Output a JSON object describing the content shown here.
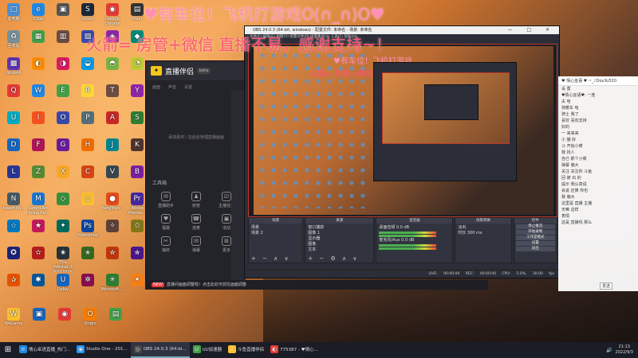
{
  "overlay": {
    "line1": "♥有车位！飞机打游戏O(∩_∩)O♥",
    "line2": "火箭= 房管+微信 直播不易，感谢支持~！"
  },
  "desktop_icons": [
    {
      "label": "此电脑",
      "color": "#4a90d9",
      "glyph": "□"
    },
    {
      "label": "Edge",
      "color": "#1e88e5",
      "glyph": "e"
    },
    {
      "label": "",
      "color": "#555",
      "glyph": "▣"
    },
    {
      "label": "Steam",
      "color": "#1b2838",
      "glyph": "S"
    },
    {
      "label": "Google Chrome",
      "color": "#e53935",
      "glyph": "◉"
    },
    {
      "label": "Steer",
      "color": "#333",
      "glyph": "▤"
    },
    {
      "label": "回收站",
      "color": "#78909c",
      "glyph": "♻"
    },
    {
      "label": "",
      "color": "#43a047",
      "glyph": "▦"
    },
    {
      "label": "",
      "color": "#6d4c41",
      "glyph": "▥"
    },
    {
      "label": "",
      "color": "#3949ab",
      "glyph": "▧"
    },
    {
      "label": "",
      "color": "#8e24aa",
      "glyph": "◈"
    },
    {
      "label": "",
      "color": "#00897b",
      "glyph": "◆"
    },
    {
      "label": "WinRAR",
      "color": "#5e35b1",
      "glyph": "▩"
    },
    {
      "label": "",
      "color": "#fb8c00",
      "glyph": "◐"
    },
    {
      "label": "",
      "color": "#d81b60",
      "glyph": "◑"
    },
    {
      "label": "",
      "color": "#039be5",
      "glyph": "◒"
    },
    {
      "label": "",
      "color": "#7cb342",
      "glyph": "◓"
    },
    {
      "label": "",
      "color": "#c0ca33",
      "glyph": "◔"
    },
    {
      "label": "",
      "color": "#e53935",
      "glyph": "Q"
    },
    {
      "label": "",
      "color": "#1e88e5",
      "glyph": "W"
    },
    {
      "label": "",
      "color": "#43a047",
      "glyph": "E"
    },
    {
      "label": "",
      "color": "#fdd835",
      "glyph": "R"
    },
    {
      "label": "",
      "color": "#6d4c41",
      "glyph": "T"
    },
    {
      "label": "",
      "color": "#8e24aa",
      "glyph": "Y"
    },
    {
      "label": "",
      "color": "#00acc1",
      "glyph": "U"
    },
    {
      "label": "",
      "color": "#f4511e",
      "glyph": "I"
    },
    {
      "label": "",
      "color": "#3949ab",
      "glyph": "O"
    },
    {
      "label": "",
      "color": "#546e7a",
      "glyph": "P"
    },
    {
      "label": "",
      "color": "#c62828",
      "glyph": "A"
    },
    {
      "label": "",
      "color": "#2e7d32",
      "glyph": "S"
    },
    {
      "label": "",
      "color": "#1565c0",
      "glyph": "D"
    },
    {
      "label": "",
      "color": "#ad1457",
      "glyph": "F"
    },
    {
      "label": "",
      "color": "#6a1b9a",
      "glyph": "G"
    },
    {
      "label": "",
      "color": "#ef6c00",
      "glyph": "H"
    },
    {
      "label": "",
      "color": "#00838f",
      "glyph": "J"
    },
    {
      "label": "",
      "color": "#4e342e",
      "glyph": "K"
    },
    {
      "label": "",
      "color": "#283593",
      "glyph": "L"
    },
    {
      "label": "",
      "color": "#558b2f",
      "glyph": "Z"
    },
    {
      "label": "",
      "color": "#f9a825",
      "glyph": "X"
    },
    {
      "label": "",
      "color": "#d84315",
      "glyph": "C"
    },
    {
      "label": "",
      "color": "#37474f",
      "glyph": "V"
    },
    {
      "label": "",
      "color": "#7b1fa2",
      "glyph": "B"
    },
    {
      "label": "Assembly...",
      "color": "#455a64",
      "glyph": "N"
    },
    {
      "label": "Sword Art Online Fat...",
      "color": "#1976d2",
      "glyph": "M"
    },
    {
      "label": "",
      "color": "#388e3c",
      "glyph": "◇"
    },
    {
      "label": "",
      "color": "#fbc02d",
      "glyph": "○"
    },
    {
      "label": "PangMan...",
      "color": "#e64a19",
      "glyph": "●"
    },
    {
      "label": "Adobe Premie...",
      "color": "#4527a0",
      "glyph": "Pr"
    },
    {
      "label": "",
      "color": "#0277bd",
      "glyph": "☆"
    },
    {
      "label": "",
      "color": "#c2185b",
      "glyph": "★"
    },
    {
      "label": "",
      "color": "#00695c",
      "glyph": "✦"
    },
    {
      "label": "Photoshop",
      "color": "#0d47a1",
      "glyph": "Ps"
    },
    {
      "label": "",
      "color": "#5d4037",
      "glyph": "✧"
    },
    {
      "label": "",
      "color": "#827717",
      "glyph": "✩"
    },
    {
      "label": "",
      "color": "#1a237e",
      "glyph": "✪"
    },
    {
      "label": "",
      "color": "#b71c1c",
      "glyph": "✫"
    },
    {
      "label": "The Witcher 3 Wild Hunt",
      "color": "#263238",
      "glyph": "✬"
    },
    {
      "label": "",
      "color": "#33691e",
      "glyph": "✭"
    },
    {
      "label": "",
      "color": "#bf360c",
      "glyph": "✮"
    },
    {
      "label": "",
      "color": "#4a148c",
      "glyph": "✯"
    },
    {
      "label": "",
      "color": "#e65100",
      "glyph": "✰"
    },
    {
      "label": "",
      "color": "#01579b",
      "glyph": "✱"
    },
    {
      "label": "Uplay",
      "color": "#1565c0",
      "glyph": "U"
    },
    {
      "label": "",
      "color": "#880e4f",
      "glyph": "✲"
    },
    {
      "label": "Microsoft ...",
      "color": "#2e7d32",
      "glyph": "✳"
    },
    {
      "label": "",
      "color": "#f57f17",
      "glyph": "✴"
    }
  ],
  "bottom_icons": [
    {
      "label": "WeGame",
      "color": "#fbc02d",
      "glyph": "W"
    },
    {
      "label": "",
      "color": "#1565c0",
      "glyph": "▣"
    },
    {
      "label": "",
      "color": "#e53935",
      "glyph": "◉"
    },
    {
      "label": "Origin",
      "color": "#f57c00",
      "glyph": "O"
    },
    {
      "label": "",
      "color": "#43a047",
      "glyph": "▤"
    }
  ],
  "companion": {
    "app_title": "直播伴侣",
    "version": "beta",
    "tabs": [
      "画面",
      "声音",
      "设置"
    ],
    "hint": "添加素材 / 在此处管理直播画面",
    "tool_label": "工具箱",
    "tools": [
      {
        "label": "直播助手",
        "glyph": "✉"
      },
      {
        "label": "房管",
        "glyph": "♟"
      },
      {
        "label": "主播任务",
        "glyph": "☑"
      },
      {
        "label": "福袋",
        "glyph": "♥"
      },
      {
        "label": "连麦",
        "glyph": "☎"
      },
      {
        "label": "活动",
        "glyph": "▣"
      },
      {
        "label": "抽奖",
        "glyph": "✂"
      },
      {
        "label": "弹幕",
        "glyph": "✉"
      },
      {
        "label": "更多",
        "glyph": "⊞"
      }
    ],
    "footer_badge": "NEW",
    "footer_text": "直播间画面调整啦！点击此处可前往画面调整"
  },
  "obs": {
    "title": "OBS 24.0.3 (64-bit, windows) - 配置文件: 未命名 - 场景: 未命名",
    "window_controls": "— □ ✕",
    "menu": "文件(F) 编辑(E) 视图(V) 配置文件(P) 场景集合(S) 工具(T) 帮助(H)",
    "docks": {
      "scenes": {
        "title": "场景",
        "items": [
          "场景",
          "场景 2"
        ]
      },
      "sources": {
        "title": "来源",
        "items": [
          "窗口捕获",
          "图像 1",
          "显示器",
          "图像",
          "文本"
        ]
      },
      "mixer": {
        "title": "混音器",
        "ch1": "桌面音频",
        "ch1_db": "0.0 dB",
        "ch2": "麦克风/Aux",
        "ch2_db": "0.0 dB"
      },
      "transitions": {
        "title": "场景转换",
        "mode": "淡出",
        "duration_label": "时长",
        "duration": "300 ms"
      },
      "controls": {
        "title": "控件",
        "buttons": [
          "停止推流",
          "开始录制",
          "工作室模式",
          "设置",
          "退出"
        ]
      }
    },
    "status": "LIVE: 00:00:00 REC: 00:00:00 CPU: 5.0%, 30.00 fps"
  },
  "nested": {
    "line1": "♥有车位！飞机打游戏",
    "line2": "火箭= 房管+微信 直播不易，感谢支持~"
  },
  "chat": {
    "header": "♥ 情心巫语 ♥ ~_♪DouYu520",
    "lines": [
      "设 置",
      "♥情心巫语♥: 一连",
      "夫 哈",
      "骑着车 哈",
      "骑士 我了",
      "喜欢 喜欢支持",
      "好的",
      "一 来来来",
      "小 猫 好",
      "斗 开始小菜",
      "我 找人",
      "自己 那个小菜",
      "弹幕 偏大",
      "关注 关注你 斗鱼",
      "回 被 出 的",
      "提示 我认真说",
      "会说 还算 你也",
      "我 偏大",
      "这里是 直播 主播",
      "天嘛 这样",
      "表情",
      "这是 直播吗 那么"
    ],
    "send": "发送"
  },
  "taskbar": {
    "start_glyph": "⊞",
    "tasks": [
      {
        "label": "情心巫语直播_热门...",
        "glyph": "e",
        "color": "#1e88e5",
        "active": false
      },
      {
        "label": "Studio One - 201...",
        "glyph": "◉",
        "color": "#2196f3",
        "active": false
      },
      {
        "label": "OBS 24.0.3 (64-bi...",
        "glyph": "◎",
        "color": "#444",
        "active": true
      },
      {
        "label": "UU加速器",
        "glyph": "U",
        "color": "#43a047",
        "active": false
      },
      {
        "label": "斗鱼直播伴侣",
        "glyph": "♪",
        "color": "#fbc02d",
        "active": false
      },
      {
        "label": "775387 - ♥情心...",
        "glyph": "◐",
        "color": "#e53935",
        "active": false
      }
    ],
    "time": "21:13",
    "date": "2022/9/3"
  }
}
